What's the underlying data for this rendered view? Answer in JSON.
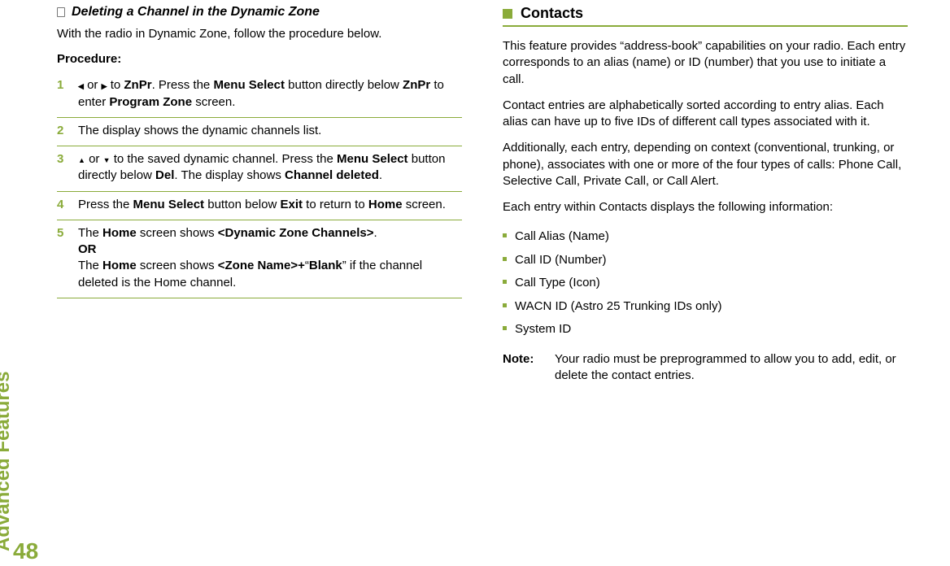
{
  "sideLabel": "Advanced Features",
  "pageNumber": "48",
  "left": {
    "heading": "Deleting a Channel in the Dynamic Zone",
    "intro": "With the radio in Dynamic Zone, follow the procedure below.",
    "procLabel": "Procedure:",
    "steps": {
      "s1": {
        "num": "1",
        "or": " or ",
        "to": " to ",
        "znpr": "ZnPr",
        "rest1": ". Press the ",
        "ms": "Menu Select",
        "rest2": " button directly below ",
        "znpr2": "ZnPr",
        "rest3": " to enter ",
        "pz": "Program Zone",
        "rest4": " screen."
      },
      "s2": {
        "num": "2",
        "text": "The display shows the dynamic channels list."
      },
      "s3": {
        "num": "3",
        "or": " or ",
        "rest1": " to the saved dynamic channel. Press the ",
        "ms": "Menu Select",
        "rest2": " button directly below ",
        "del": "Del",
        "rest3": ". The display shows ",
        "cd": "Channel deleted",
        "rest4": "."
      },
      "s4": {
        "num": "4",
        "rest1": "Press the ",
        "ms": "Menu Select",
        "rest2": " button below ",
        "exit": "Exit",
        "rest3": " to return to ",
        "home": "Home",
        "rest4": " screen."
      },
      "s5": {
        "num": "5",
        "rest1": "The ",
        "home1": "Home",
        "rest2": " screen shows ",
        "dzc": "<Dynamic Zone Channels>",
        "rest3": ".",
        "or": "OR",
        "rest4": "The ",
        "home2": "Home",
        "rest5": " screen shows ",
        "zn": "<Zone Name>+",
        "q1": "“",
        "blank": "Blank",
        "q2": "” if the channel deleted is the Home channel."
      }
    }
  },
  "right": {
    "heading": "Contacts",
    "p1": "This feature provides “address-book” capabilities on your radio. Each entry corresponds to an alias (name) or ID (number) that you use to initiate a call.",
    "p2": "Contact entries are alphabetically sorted according to entry alias. Each alias can have up to five IDs of different call types associated with it.",
    "p3": "Additionally, each entry, depending on context (conventional, trunking, or phone), associates with one or more of the four types of calls: Phone Call, Selective Call, Private Call, or Call Alert.",
    "p4": "Each entry within Contacts displays the following information:",
    "bullets": [
      "Call Alias (Name)",
      "Call ID (Number)",
      "Call Type (Icon)",
      "WACN ID (Astro 25 Trunking IDs only)",
      "System ID"
    ],
    "noteLabel": "Note:",
    "noteText": "Your radio must be preprogrammed to allow you to add, edit, or delete the contact entries."
  }
}
